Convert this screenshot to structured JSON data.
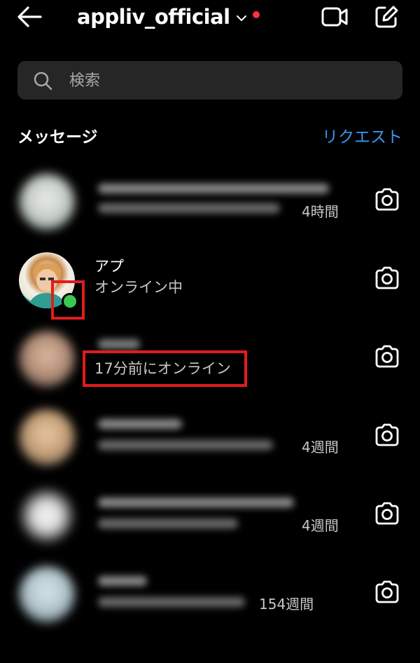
{
  "header": {
    "account_name": "appliv_official"
  },
  "search": {
    "placeholder": "検索"
  },
  "section": {
    "title": "メッセージ",
    "requests_label": "リクエスト"
  },
  "threads": [
    {
      "name": "",
      "subtitle": "",
      "time": "4時間",
      "blurred": true
    },
    {
      "name": "アプ",
      "subtitle": "オンライン中",
      "time": "",
      "blurred": false,
      "online": true
    },
    {
      "name": "",
      "subtitle": "17分前にオンライン",
      "time": "",
      "blurred": true
    },
    {
      "name": "",
      "subtitle": "",
      "time": "4週間",
      "blurred": true
    },
    {
      "name": "",
      "subtitle": "",
      "time": "4週間",
      "blurred": true
    },
    {
      "name": "",
      "subtitle": "",
      "time": "154週間",
      "blurred": true
    }
  ],
  "colors": {
    "accent": "#3897f0",
    "notification": "#ff3040",
    "online": "#3cc850",
    "highlight": "#e01d1d",
    "background": "#000000",
    "search_bg": "#262626"
  },
  "icons": {
    "back": "arrow-left-icon",
    "dropdown": "chevron-down-icon",
    "video": "video-camera-icon",
    "compose": "compose-icon",
    "search": "search-icon",
    "camera": "camera-icon"
  }
}
